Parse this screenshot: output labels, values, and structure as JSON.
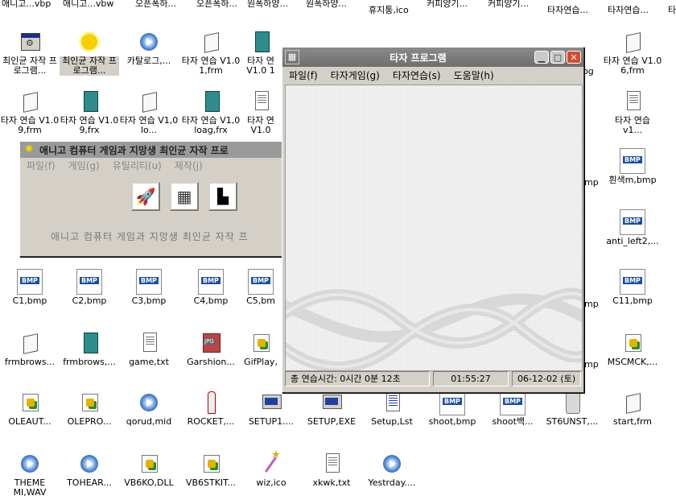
{
  "desktop": {
    "top_row": [
      "애니고...vbp",
      "애니고...vbw",
      "오픈폭하...",
      "오픈폭하...",
      "원폭하양...",
      "원폭하양...",
      "휴지통,ico",
      "커피양기...",
      "커피양기...",
      "타자연습...",
      "타자연습...",
      "타"
    ],
    "icons": [
      {
        "label": "최인균 자작 프로그램...",
        "icon": "app-icon"
      },
      {
        "label": "최인균 자작 프로그램...",
        "icon": "sun-icon"
      },
      {
        "label": "카탈로그,...",
        "icon": "media-icon"
      },
      {
        "label": "타자 연습 V1.0 1,frm",
        "icon": "form-file-icon"
      },
      {
        "label": "타자 연 V1.0 1",
        "icon": "frx-file-icon"
      },
      {
        "label": "타자 연습 V1.0 9,frm",
        "icon": "form-file-icon"
      },
      {
        "label": "타자 연습 V1.0 9,frx",
        "icon": "frx-file-icon"
      },
      {
        "label": "타자 연습 V1,0 lo...",
        "icon": "form-file-icon"
      },
      {
        "label": "타자 연습 V1,0 loag,frx",
        "icon": "frx-file-icon"
      },
      {
        "label": "타자 연 V1.0",
        "icon": "text-file-icon"
      },
      {
        "label": "C1,bmp",
        "icon": "bmp-file-icon"
      },
      {
        "label": "C2,bmp",
        "icon": "bmp-file-icon"
      },
      {
        "label": "C3,bmp",
        "icon": "bmp-file-icon"
      },
      {
        "label": "C4,bmp",
        "icon": "bmp-file-icon"
      },
      {
        "label": "C5,bm",
        "icon": "bmp-file-icon"
      },
      {
        "label": "frmbrows...",
        "icon": "form-file-icon"
      },
      {
        "label": "frmbrows,...",
        "icon": "frx-file-icon"
      },
      {
        "label": "game,txt",
        "icon": "text-file-icon"
      },
      {
        "label": "Garshion...",
        "icon": "jpg-file-icon"
      },
      {
        "label": "GifPlay,",
        "icon": "dll-file-icon"
      },
      {
        "label": "OLEAUT...",
        "icon": "dll-file-icon"
      },
      {
        "label": "OLEPRO...",
        "icon": "dll-file-icon"
      },
      {
        "label": "qorud,mid",
        "icon": "media-icon"
      },
      {
        "label": "ROCKET,...",
        "icon": "rocket-icon"
      },
      {
        "label": "SETUP1....",
        "icon": "setup-icon"
      },
      {
        "label": "SETUP,EXE",
        "icon": "setup-icon"
      },
      {
        "label": "Setup,Lst",
        "icon": "list-file-icon"
      },
      {
        "label": "shoot,bmp",
        "icon": "bmp-file-icon"
      },
      {
        "label": "shoot백...",
        "icon": "bmp-file-icon"
      },
      {
        "label": "ST6UNST,...",
        "icon": "recycle-icon"
      },
      {
        "label": "start,frm",
        "icon": "form-file-icon"
      },
      {
        "label": "THEME MI,WAV",
        "icon": "media-icon"
      },
      {
        "label": "TOHEAR...",
        "icon": "media-icon"
      },
      {
        "label": "VB6KO,DLL",
        "icon": "dll-file-icon"
      },
      {
        "label": "VB6STKIT...",
        "icon": "dll-file-icon"
      },
      {
        "label": "wiz,ico",
        "icon": "wand-icon"
      },
      {
        "label": "xkwk,txt",
        "icon": "text-file-icon"
      },
      {
        "label": "Yestrday....",
        "icon": "media-icon"
      },
      {
        "label": "타자 연습 V1.0 6,frm",
        "icon": "form-file-icon"
      },
      {
        "label": "타자 연습v1...",
        "icon": "text-file-icon"
      },
      {
        "label": "흰색m,bmp",
        "icon": "bmp-file-icon"
      },
      {
        "label": "anti_left2,...",
        "icon": "bmp-file-icon"
      },
      {
        "label": "C11,bmp",
        "icon": "bmp-file-icon"
      },
      {
        "label": "MSCMCK,...",
        "icon": "dll-file-icon"
      },
      {
        "label": "og",
        "icon": "none"
      },
      {
        "label": "mp",
        "icon": "none"
      },
      {
        "label": "mp",
        "icon": "none"
      },
      {
        "label": "mp",
        "icon": "none"
      },
      {
        "label": "m,",
        "icon": "none"
      }
    ]
  },
  "launcher_window": {
    "title": "애니고 컴퓨터 게임과 지망생 최인균 자작 프로",
    "menu": [
      "파일(f)",
      "게임(g)",
      "유틸리티(u)",
      "제작(j)"
    ],
    "buttons": [
      "rocket-game",
      "keyboard-game",
      "typing-game"
    ],
    "footer_text": "애니고 컴퓨터 게임과 지망생 최인균 자작 프"
  },
  "typing_window": {
    "title": "타자 프로그램",
    "menu": [
      "파일(f)",
      "타자게임(g)",
      "타자연습(s)",
      "도움말(h)"
    ],
    "status": {
      "total_time": "총 연습시간: 0시간 0분 12초",
      "clock": "01:55:27",
      "date": "06-12-02 (토)"
    }
  },
  "colors": {
    "title_active": "#7b7b7b",
    "title_inactive": "#9a9a9a",
    "face": "#d4d0c8",
    "close_red": "#d84a30"
  }
}
